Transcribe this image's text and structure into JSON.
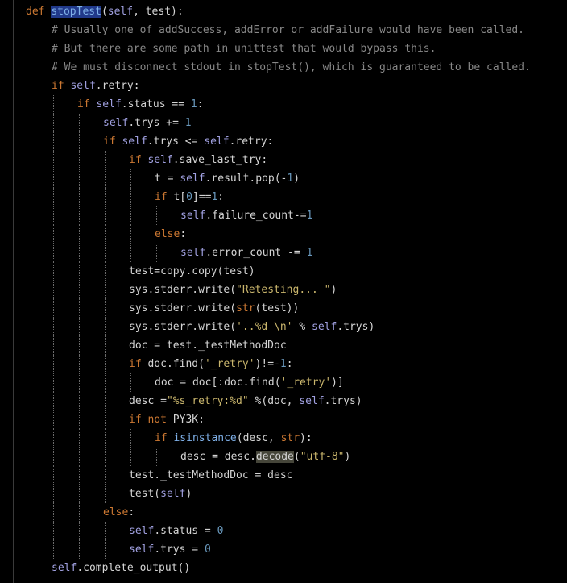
{
  "editor": {
    "background": "#000000",
    "language": "python",
    "lines": [
      {
        "indent": 0,
        "tokens": [
          [
            "kw",
            "def "
          ],
          [
            "hldef",
            "stopTest"
          ],
          [
            "txt",
            "("
          ],
          [
            "self",
            "self"
          ],
          [
            "txt",
            ", test):"
          ]
        ]
      },
      {
        "indent": 1,
        "tokens": [
          [
            "cmt",
            "# Usually one of addSuccess, addError or addFailure would have been called."
          ]
        ]
      },
      {
        "indent": 1,
        "tokens": [
          [
            "cmt",
            "# But there are some path in unittest that would bypass this."
          ]
        ]
      },
      {
        "indent": 1,
        "tokens": [
          [
            "cmt",
            "# We must disconnect stdout in stopTest(), which is guaranteed to be called."
          ]
        ]
      },
      {
        "indent": 1,
        "tokens": [
          [
            "kw",
            "if "
          ],
          [
            "self",
            "self"
          ],
          [
            "txt",
            ".retry"
          ],
          [
            "under",
            ":"
          ]
        ]
      },
      {
        "indent": 2,
        "tokens": [
          [
            "kw",
            "if "
          ],
          [
            "self",
            "self"
          ],
          [
            "txt",
            ".status == "
          ],
          [
            "num",
            "1"
          ],
          [
            "txt",
            ":"
          ]
        ]
      },
      {
        "indent": 3,
        "tokens": [
          [
            "self",
            "self"
          ],
          [
            "txt",
            ".trys += "
          ],
          [
            "num",
            "1"
          ]
        ]
      },
      {
        "indent": 3,
        "tokens": [
          [
            "kw",
            "if "
          ],
          [
            "self",
            "self"
          ],
          [
            "txt",
            ".trys <= "
          ],
          [
            "self",
            "self"
          ],
          [
            "txt",
            ".retry:"
          ]
        ]
      },
      {
        "indent": 4,
        "tokens": [
          [
            "kw",
            "if "
          ],
          [
            "self",
            "self"
          ],
          [
            "txt",
            ".save_last_try:"
          ]
        ]
      },
      {
        "indent": 5,
        "tokens": [
          [
            "txt",
            "t = "
          ],
          [
            "self",
            "self"
          ],
          [
            "txt",
            ".result.pop(-"
          ],
          [
            "num",
            "1"
          ],
          [
            "txt",
            ")"
          ]
        ]
      },
      {
        "indent": 5,
        "tokens": [
          [
            "kw",
            "if "
          ],
          [
            "txt",
            "t["
          ],
          [
            "num",
            "0"
          ],
          [
            "txt",
            "]=="
          ],
          [
            "num",
            "1"
          ],
          [
            "txt",
            ":"
          ]
        ]
      },
      {
        "indent": 6,
        "tokens": [
          [
            "self",
            "self"
          ],
          [
            "txt",
            ".failure_count-="
          ],
          [
            "num",
            "1"
          ]
        ]
      },
      {
        "indent": 5,
        "tokens": [
          [
            "kw",
            "else"
          ],
          [
            "txt",
            ":"
          ]
        ]
      },
      {
        "indent": 6,
        "tokens": [
          [
            "self",
            "self"
          ],
          [
            "txt",
            ".error_count -= "
          ],
          [
            "num",
            "1"
          ]
        ]
      },
      {
        "indent": 4,
        "tokens": [
          [
            "txt",
            "test=copy.copy(test)"
          ]
        ]
      },
      {
        "indent": 4,
        "tokens": [
          [
            "txt",
            "sys.stderr.write("
          ],
          [
            "str",
            "\"Retesting... \""
          ],
          [
            "txt",
            ")"
          ]
        ]
      },
      {
        "indent": 4,
        "tokens": [
          [
            "txt",
            "sys.stderr.write("
          ],
          [
            "kw",
            "str"
          ],
          [
            "txt",
            "(test))"
          ]
        ]
      },
      {
        "indent": 4,
        "tokens": [
          [
            "txt",
            "sys.stderr.write("
          ],
          [
            "str",
            "'..%d \\n'"
          ],
          [
            "txt",
            " % "
          ],
          [
            "self",
            "self"
          ],
          [
            "txt",
            ".trys)"
          ]
        ]
      },
      {
        "indent": 4,
        "tokens": [
          [
            "txt",
            "doc = test._testMethodDoc"
          ]
        ]
      },
      {
        "indent": 4,
        "tokens": [
          [
            "kw",
            "if "
          ],
          [
            "txt",
            "doc.find("
          ],
          [
            "str",
            "'_retry'"
          ],
          [
            "txt",
            ")!=-"
          ],
          [
            "num",
            "1"
          ],
          [
            "txt",
            ":"
          ]
        ]
      },
      {
        "indent": 5,
        "tokens": [
          [
            "txt",
            "doc = doc[:doc.find("
          ],
          [
            "str",
            "'_retry'"
          ],
          [
            "txt",
            ")]"
          ]
        ]
      },
      {
        "indent": 4,
        "tokens": [
          [
            "txt",
            "desc ="
          ],
          [
            "str",
            "\"%s_retry:%d\""
          ],
          [
            "txt",
            " %(doc, "
          ],
          [
            "self",
            "self"
          ],
          [
            "txt",
            ".trys)"
          ]
        ]
      },
      {
        "indent": 4,
        "tokens": [
          [
            "kw",
            "if not "
          ],
          [
            "txt",
            "PY3K:"
          ]
        ]
      },
      {
        "indent": 5,
        "tokens": [
          [
            "kw",
            "if "
          ],
          [
            "fn",
            "isinstance"
          ],
          [
            "txt",
            "(desc, "
          ],
          [
            "kw",
            "str"
          ],
          [
            "txt",
            "):"
          ]
        ]
      },
      {
        "indent": 6,
        "tokens": [
          [
            "txt",
            "desc = desc."
          ],
          [
            "hlword",
            "decode"
          ],
          [
            "txt",
            "("
          ],
          [
            "str",
            "\"utf-8\""
          ],
          [
            "txt",
            ")"
          ]
        ]
      },
      {
        "indent": 4,
        "tokens": [
          [
            "txt",
            "test._testMethodDoc = desc"
          ]
        ]
      },
      {
        "indent": 4,
        "tokens": [
          [
            "txt",
            "test("
          ],
          [
            "self",
            "self"
          ],
          [
            "txt",
            ")"
          ]
        ]
      },
      {
        "indent": 3,
        "tokens": [
          [
            "kw",
            "else"
          ],
          [
            "txt",
            ":"
          ]
        ]
      },
      {
        "indent": 4,
        "tokens": [
          [
            "self",
            "self"
          ],
          [
            "txt",
            ".status = "
          ],
          [
            "num",
            "0"
          ]
        ]
      },
      {
        "indent": 4,
        "tokens": [
          [
            "self",
            "self"
          ],
          [
            "txt",
            ".trys = "
          ],
          [
            "num",
            "0"
          ]
        ]
      },
      {
        "indent": 1,
        "tokens": [
          [
            "self",
            "self"
          ],
          [
            "txt",
            ".complete_output()"
          ]
        ]
      }
    ]
  }
}
